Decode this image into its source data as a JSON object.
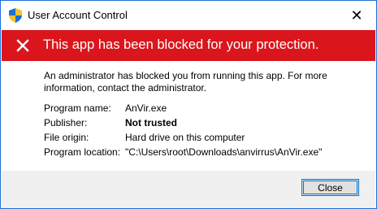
{
  "window": {
    "title": "User Account Control",
    "close_glyph": "✕"
  },
  "banner": {
    "icon": "blocked-x-icon",
    "color": "#da161c",
    "text": "This app has been blocked for your protection."
  },
  "message": "An administrator has blocked you from running this app. For more information, contact the administrator.",
  "details": {
    "program_name": {
      "label": "Program name:",
      "value": "AnVir.exe"
    },
    "publisher": {
      "label": "Publisher:",
      "value": "Not trusted"
    },
    "file_origin": {
      "label": "File origin:",
      "value": "Hard drive on this computer"
    },
    "program_location": {
      "label": "Program location:",
      "value": "\"C:\\Users\\root\\Downloads\\anvirrus\\AnVir.exe\""
    }
  },
  "footer": {
    "close_label": "Close"
  }
}
